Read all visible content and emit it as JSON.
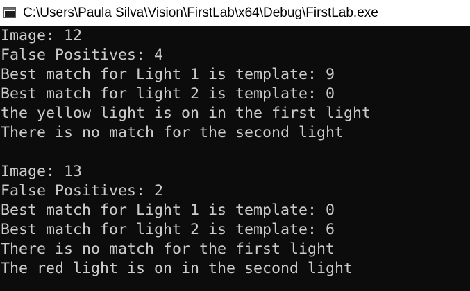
{
  "window": {
    "title": "C:\\Users\\Paula Silva\\Vision\\FirstLab\\x64\\Debug\\FirstLab.exe",
    "icon": "console-app-icon"
  },
  "colors": {
    "titlebar_bg": "#ffffff",
    "console_bg": "#0c0c0c",
    "console_text": "#cccccc"
  },
  "console": {
    "lines": [
      "Image: 12",
      "False Positives: 4",
      "Best match for Light 1 is template: 9",
      "Best match for light 2 is template: 0",
      "the yellow light is on in the first light",
      "There is no match for the second light",
      "",
      "Image: 13",
      "False Positives: 2",
      "Best match for Light 1 is template: 0",
      "Best match for light 2 is template: 6",
      "There is no match for the first light",
      "The red light is on in the second light"
    ]
  }
}
